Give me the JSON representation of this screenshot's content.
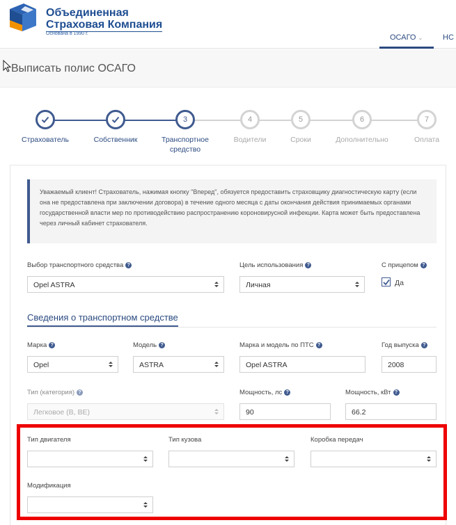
{
  "header": {
    "brand_line1": "Объединенная",
    "brand_line2": "Страховая Компания",
    "brand_line3": "Основана в 1990 г.",
    "nav": [
      {
        "label": "ОСАГО",
        "chevron": "⌄"
      },
      {
        "label": "НС"
      }
    ],
    "logo_icon": "cube-logo-icon"
  },
  "page_title": "Выписать полис ОСАГО",
  "stepper": {
    "steps": [
      {
        "label": "Страхователь",
        "state": "done",
        "number": ""
      },
      {
        "label": "Собственник",
        "state": "done",
        "number": ""
      },
      {
        "label": "Транспортное средство",
        "state": "current",
        "number": "3"
      },
      {
        "label": "Водители",
        "state": "todo",
        "number": "4"
      },
      {
        "label": "Сроки",
        "state": "todo",
        "number": "5"
      },
      {
        "label": "Дополнительно",
        "state": "todo",
        "number": "6"
      },
      {
        "label": "Оплата",
        "state": "todo",
        "number": "7"
      }
    ]
  },
  "notice": "Уважаемый клиент! Страхователь, нажимая кнопку \"Вперед\", обязуется предоставить страховщику диагностическую карту (если она не предоставлена при заключении договора) в течение одного месяца с даты окончания действия принимаемых органами государственной власти мер по противодействию распространению короновирусной инфекции. Карта может быть предоставлена через личный кабинет страхователя.",
  "form": {
    "vehicle_select": {
      "label": "Выбор транспортного средства",
      "value": "Opel ASTRA"
    },
    "usage_purpose": {
      "label": "Цель использования",
      "value": "Личная"
    },
    "trailer": {
      "label": "С прицепом",
      "option": "Да",
      "checked": true
    },
    "section_title": "Сведения о транспортном средстве",
    "make": {
      "label": "Марка",
      "value": "Opel"
    },
    "model": {
      "label": "Модель",
      "value": "ASTRA"
    },
    "pts_make_model": {
      "label": "Марка и модель по ПТС",
      "value": "Opel ASTRA"
    },
    "year": {
      "label": "Год выпуска",
      "value": "2008"
    },
    "category": {
      "label": "Тип (категория)",
      "value": "Легковое (B, BE)"
    },
    "power_hp": {
      "label": "Мощность, лс",
      "value": "90"
    },
    "power_kw": {
      "label": "Мощность, кВт",
      "value": "66.2"
    },
    "engine_type": {
      "label": "Тип двигателя",
      "value": ""
    },
    "body_type": {
      "label": "Тип кузова",
      "value": ""
    },
    "gearbox": {
      "label": "Коробка передач",
      "value": ""
    },
    "modification": {
      "label": "Модификация",
      "value": ""
    }
  },
  "colors": {
    "primary": "#3f5a8f",
    "highlight": "#ee0000",
    "inactive": "#d3d3d3"
  }
}
